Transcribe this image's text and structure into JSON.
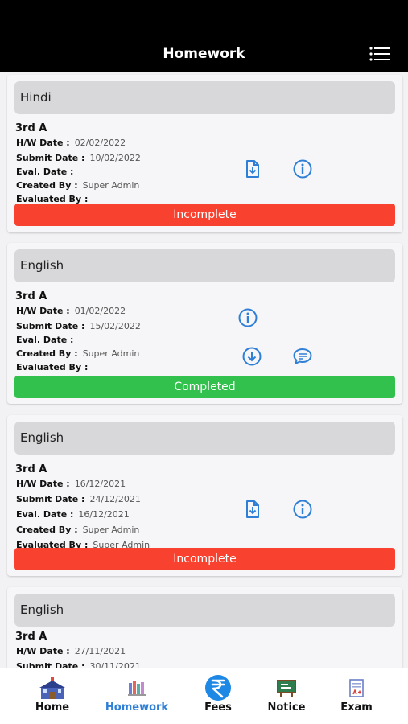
{
  "header": {
    "title": "Homework"
  },
  "labels": {
    "hw_date": "H/W Date :",
    "submit_date": "Submit Date :",
    "eval_date": "Eval. Date :",
    "created_by": "Created By :",
    "evaluated_by": "Evaluated By :"
  },
  "homework": [
    {
      "subject": "Hindi",
      "class": "3rd A",
      "hw_date": "02/02/2022",
      "submit_date": "10/02/2022",
      "eval_date": "",
      "created_by": "Super Admin",
      "evaluated_by": "",
      "status": "Incomplete",
      "icons": [
        "upload-doc-icon",
        "info-icon"
      ]
    },
    {
      "subject": "English",
      "class": "3rd A",
      "hw_date": "01/02/2022",
      "submit_date": "15/02/2022",
      "eval_date": "",
      "created_by": "Super Admin",
      "evaluated_by": "",
      "status": "Completed",
      "icons": [
        "info-icon",
        "download-icon",
        "comment-icon"
      ]
    },
    {
      "subject": "English",
      "class": "3rd A",
      "hw_date": "16/12/2021",
      "submit_date": "24/12/2021",
      "eval_date": "16/12/2021",
      "created_by": "Super Admin",
      "evaluated_by": "Super Admin",
      "status": "Incomplete",
      "icons": [
        "upload-doc-icon",
        "info-icon"
      ]
    },
    {
      "subject": "English",
      "class": "3rd A",
      "hw_date": "27/11/2021",
      "submit_date": "30/11/2021"
    }
  ],
  "nav": [
    {
      "label": "Home",
      "icon": "school-icon"
    },
    {
      "label": "Homework",
      "icon": "books-icon",
      "active": true
    },
    {
      "label": "Fees",
      "icon": "rupee-icon"
    },
    {
      "label": "Notice",
      "icon": "notice-board-icon"
    },
    {
      "label": "Exam",
      "icon": "exam-paper-icon"
    }
  ],
  "colors": {
    "incomplete": "#f8412f",
    "completed": "#33c14e",
    "accent": "#2f7fd6"
  }
}
